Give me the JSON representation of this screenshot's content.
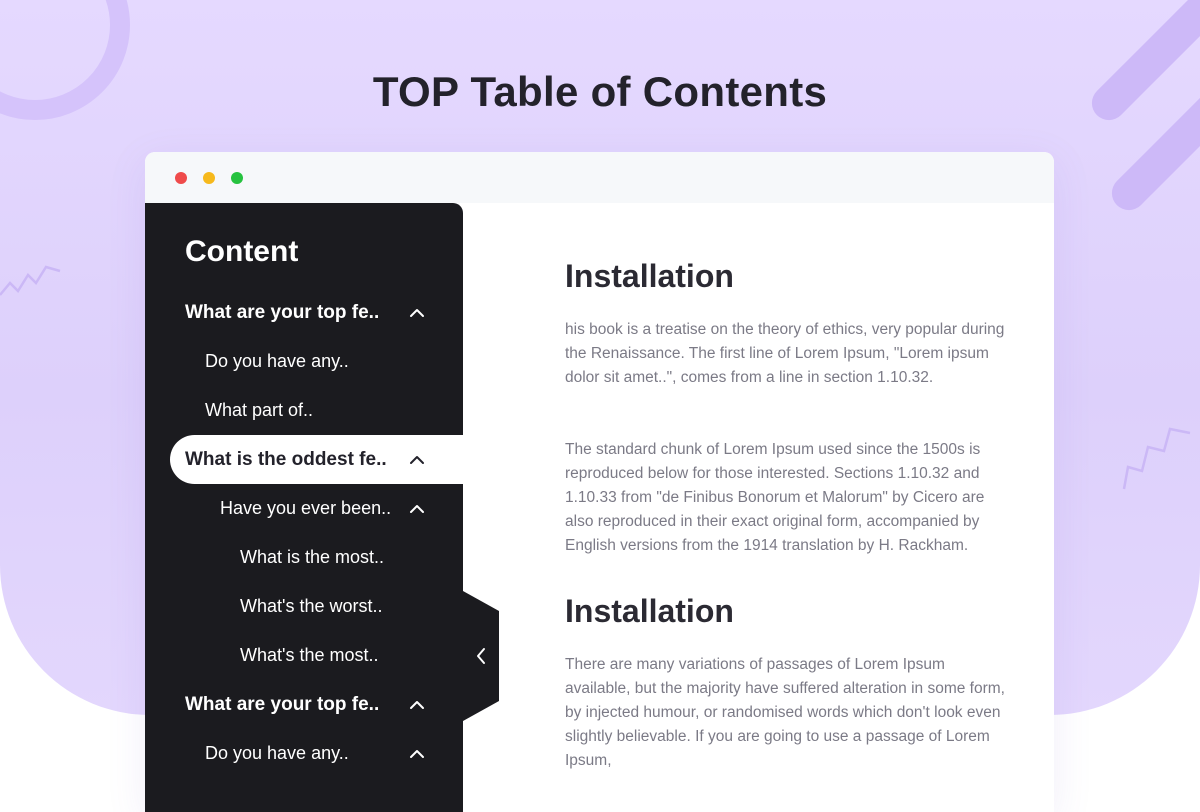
{
  "page": {
    "title": "TOP Table of Contents"
  },
  "window": {
    "controls": [
      "close",
      "minimize",
      "maximize"
    ]
  },
  "sidebar": {
    "title": "Content",
    "items": [
      {
        "label": "What are your top fe..",
        "level": 1,
        "chevron": "chevron-up-icon"
      },
      {
        "label": "Do you have any..",
        "level": 2
      },
      {
        "label": "What part of..",
        "level": 2
      },
      {
        "label": "What is the oddest fe..",
        "level": 1,
        "chevron": "chevron-up-icon",
        "active": true
      },
      {
        "label": "Have you ever been..",
        "level": 2,
        "chevron": "chevron-up-icon"
      },
      {
        "label": "What is the most..",
        "level": 3
      },
      {
        "label": "What's the worst..",
        "level": 3
      },
      {
        "label": "What's the most..",
        "level": 3
      },
      {
        "label": "What are your top fe..",
        "level": 1,
        "chevron": "chevron-up-icon"
      },
      {
        "label": "Do you have any..",
        "level": 2,
        "chevron": "chevron-up-icon"
      }
    ],
    "collapse_icon": "chevron-left-icon"
  },
  "content": {
    "sections": [
      {
        "heading": "Installation",
        "paragraphs": [
          "his book is a treatise on the theory of ethics, very popular during the Renaissance. The first line of Lorem Ipsum, \"Lorem ipsum dolor sit amet..\", comes from a line in section 1.10.32.",
          "The standard chunk of Lorem Ipsum used since the 1500s is reproduced below for those interested. Sections 1.10.32 and 1.10.33 from \"de Finibus Bonorum et Malorum\" by Cicero are also reproduced in their exact original form, accompanied by English versions from the 1914 translation by H. Rackham."
        ]
      },
      {
        "heading": "Installation",
        "paragraphs": [
          "There are many variations of passages of Lorem Ipsum available, but the majority have suffered alteration in some form, by injected humour, or randomised words which don't look even slightly believable. If you are going to use a passage of Lorem Ipsum,"
        ]
      }
    ]
  },
  "colors": {
    "background": "#e5d9ff",
    "sidebar": "#1b1b1f",
    "active_item": "#ffffff",
    "heading": "#2b2a33",
    "body_text": "#7b7a86",
    "dot_red": "#ef4b4b",
    "dot_yellow": "#f6b91c",
    "dot_green": "#26c23f"
  }
}
